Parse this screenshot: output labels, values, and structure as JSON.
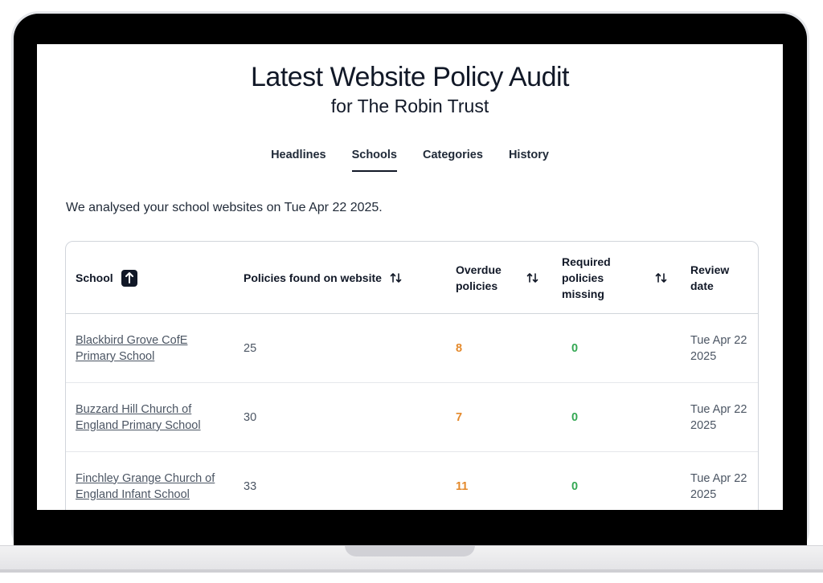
{
  "page": {
    "title": "Latest Website Policy Audit",
    "subtitle": "for The Robin Trust",
    "intro": "We analysed your school websites on Tue Apr 22 2025."
  },
  "tabs": [
    {
      "label": "Headlines",
      "active": false
    },
    {
      "label": "Schools",
      "active": true
    },
    {
      "label": "Categories",
      "active": false
    },
    {
      "label": "History",
      "active": false
    }
  ],
  "table": {
    "columns": {
      "school": "School",
      "policies_found": "Policies found on website",
      "overdue_line1": "Overdue",
      "overdue_line2": "policies",
      "missing_line1": "Required",
      "missing_line2": "policies",
      "missing_line3": "missing",
      "review_line1": "Review",
      "review_line2": "date"
    },
    "icons": {
      "sort_active": "arrow-up-icon",
      "sort": "sort-arrows-icon"
    },
    "rows": [
      {
        "school_line1": "Blackbird Grove CofE",
        "school_line2": "Primary School",
        "policies_found": "25",
        "overdue": "8",
        "missing": "0",
        "review_line1": "Tue Apr 22",
        "review_line2": "2025"
      },
      {
        "school_line1": "Buzzard Hill Church of",
        "school_line2": "England Primary School",
        "policies_found": "30",
        "overdue": "7",
        "missing": "0",
        "review_line1": "Tue Apr 22",
        "review_line2": "2025"
      },
      {
        "school_line1": "Finchley Grange Church of",
        "school_line2": "England Infant School",
        "policies_found": "33",
        "overdue": "11",
        "missing": "0",
        "review_line1": "Tue Apr 22",
        "review_line2": "2025"
      }
    ]
  },
  "colors": {
    "overdue": "#e4892b",
    "missing": "#34a853",
    "bezel": "#000000"
  }
}
